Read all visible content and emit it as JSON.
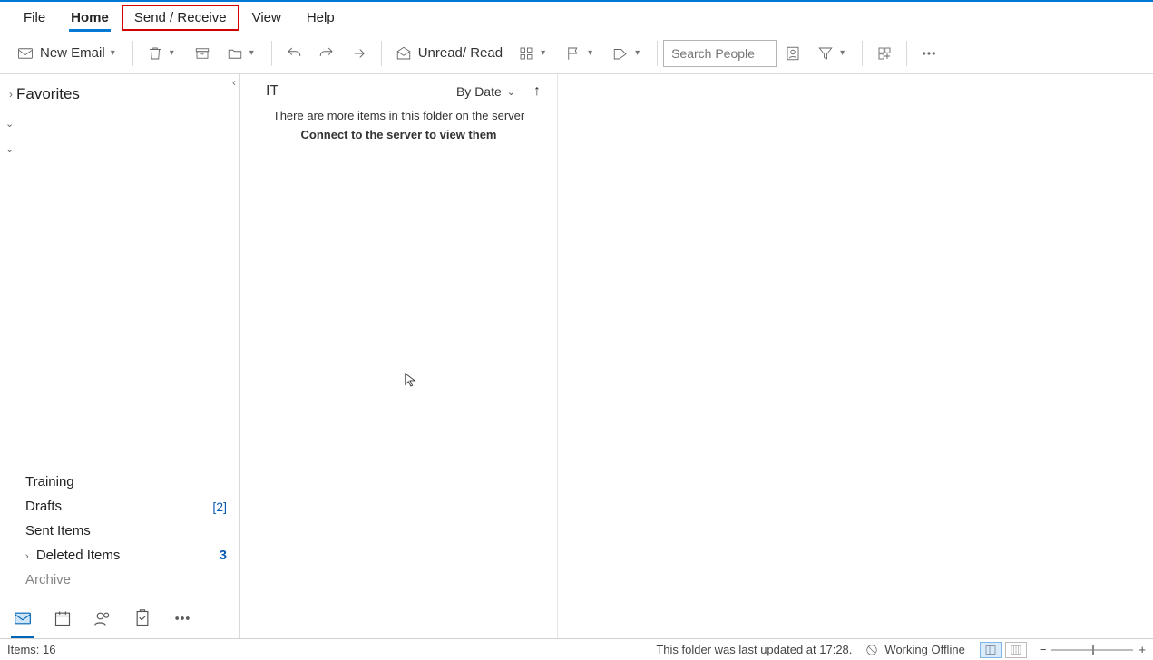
{
  "tabs": {
    "file": "File",
    "home": "Home",
    "send_receive": "Send / Receive",
    "view": "View",
    "help": "Help"
  },
  "ribbon": {
    "new_email": "New Email",
    "unread_read": "Unread/ Read",
    "search_placeholder": "Search People"
  },
  "nav": {
    "favorites": "Favorites",
    "folders": {
      "training": "Training",
      "drafts": "Drafts",
      "drafts_count": "[2]",
      "sent": "Sent Items",
      "deleted": "Deleted Items",
      "deleted_count": "3",
      "archive": "Archive"
    }
  },
  "list": {
    "title": "IT",
    "sort_label": "By Date",
    "server_msg_line1": "There are more items in this folder on the server",
    "server_msg_line2": "Connect to the server to view them"
  },
  "status": {
    "items": "Items: 16",
    "updated": "This folder was last updated at 17:28.",
    "offline": "Working Offline"
  }
}
